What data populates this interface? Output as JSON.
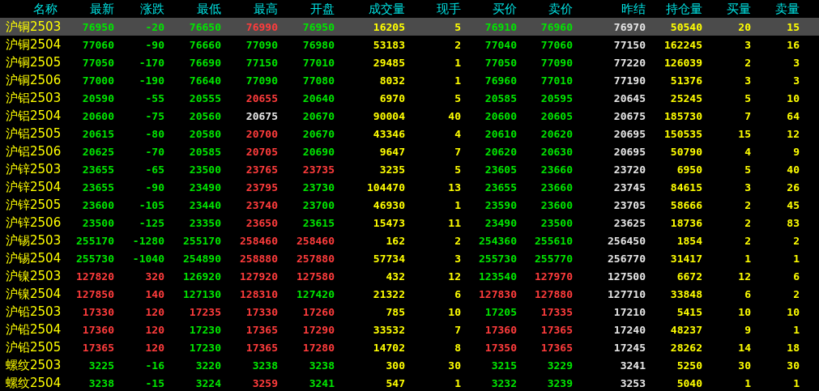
{
  "columns": [
    {
      "label": "名称"
    },
    {
      "label": "最新"
    },
    {
      "label": "涨跌"
    },
    {
      "label": "最低"
    },
    {
      "label": "最高"
    },
    {
      "label": "开盘"
    },
    {
      "label": "成交量",
      "color": "#ffff00"
    },
    {
      "label": "现手",
      "color": "#ffff00"
    },
    {
      "label": "买价"
    },
    {
      "label": "卖价"
    },
    {
      "label": "昨结",
      "color": "#e6e6e6"
    },
    {
      "label": "持仓量",
      "color": "#ffff00"
    },
    {
      "label": "买量",
      "color": "#ffff00"
    },
    {
      "label": "卖量",
      "color": "#ffff00"
    }
  ],
  "rows": [
    {
      "name": "沪铜2503",
      "selected": true,
      "cells": [
        {
          "text": "76950",
          "color": "#00e600"
        },
        {
          "text": "-20",
          "color": "#00e600"
        },
        {
          "text": "76650",
          "color": "#00e600"
        },
        {
          "text": "76990",
          "color": "#ff3c3c"
        },
        {
          "text": "76950",
          "color": "#00e600"
        },
        "16205",
        "5",
        {
          "text": "76910",
          "color": "#00e600"
        },
        {
          "text": "76960",
          "color": "#00e600"
        },
        "76970",
        "50540",
        "20",
        "15"
      ]
    },
    {
      "name": "沪铜2504",
      "selected": false,
      "cells": [
        {
          "text": "77060",
          "color": "#00e600"
        },
        {
          "text": "-90",
          "color": "#00e600"
        },
        {
          "text": "76660",
          "color": "#00e600"
        },
        {
          "text": "77090",
          "color": "#00e600"
        },
        {
          "text": "76980",
          "color": "#00e600"
        },
        "53183",
        "2",
        {
          "text": "77040",
          "color": "#00e600"
        },
        {
          "text": "77060",
          "color": "#00e600"
        },
        "77150",
        "162245",
        "3",
        "16"
      ]
    },
    {
      "name": "沪铜2505",
      "selected": false,
      "cells": [
        {
          "text": "77050",
          "color": "#00e600"
        },
        {
          "text": "-170",
          "color": "#00e600"
        },
        {
          "text": "76690",
          "color": "#00e600"
        },
        {
          "text": "77150",
          "color": "#00e600"
        },
        {
          "text": "77010",
          "color": "#00e600"
        },
        "29485",
        "1",
        {
          "text": "77050",
          "color": "#00e600"
        },
        {
          "text": "77090",
          "color": "#00e600"
        },
        "77220",
        "126039",
        "2",
        "3"
      ]
    },
    {
      "name": "沪铜2506",
      "selected": false,
      "cells": [
        {
          "text": "77000",
          "color": "#00e600"
        },
        {
          "text": "-190",
          "color": "#00e600"
        },
        {
          "text": "76640",
          "color": "#00e600"
        },
        {
          "text": "77090",
          "color": "#00e600"
        },
        {
          "text": "77080",
          "color": "#00e600"
        },
        "8032",
        "1",
        {
          "text": "76960",
          "color": "#00e600"
        },
        {
          "text": "77010",
          "color": "#00e600"
        },
        "77190",
        "51376",
        "3",
        "3"
      ]
    },
    {
      "name": "沪铝2503",
      "selected": false,
      "cells": [
        {
          "text": "20590",
          "color": "#00e600"
        },
        {
          "text": "-55",
          "color": "#00e600"
        },
        {
          "text": "20555",
          "color": "#00e600"
        },
        {
          "text": "20655",
          "color": "#ff3c3c"
        },
        {
          "text": "20640",
          "color": "#00e600"
        },
        "6970",
        "5",
        {
          "text": "20585",
          "color": "#00e600"
        },
        {
          "text": "20595",
          "color": "#00e600"
        },
        "20645",
        "25245",
        "5",
        "10"
      ]
    },
    {
      "name": "沪铝2504",
      "selected": false,
      "cells": [
        {
          "text": "20600",
          "color": "#00e600"
        },
        {
          "text": "-75",
          "color": "#00e600"
        },
        {
          "text": "20560",
          "color": "#00e600"
        },
        {
          "text": "20675",
          "color": "#e6e6e6"
        },
        {
          "text": "20670",
          "color": "#00e600"
        },
        "90004",
        "40",
        {
          "text": "20600",
          "color": "#00e600"
        },
        {
          "text": "20605",
          "color": "#00e600"
        },
        "20675",
        "185730",
        "7",
        "64"
      ]
    },
    {
      "name": "沪铝2505",
      "selected": false,
      "cells": [
        {
          "text": "20615",
          "color": "#00e600"
        },
        {
          "text": "-80",
          "color": "#00e600"
        },
        {
          "text": "20580",
          "color": "#00e600"
        },
        {
          "text": "20700",
          "color": "#ff3c3c"
        },
        {
          "text": "20670",
          "color": "#00e600"
        },
        "43346",
        "4",
        {
          "text": "20610",
          "color": "#00e600"
        },
        {
          "text": "20620",
          "color": "#00e600"
        },
        "20695",
        "150535",
        "15",
        "12"
      ]
    },
    {
      "name": "沪铝2506",
      "selected": false,
      "cells": [
        {
          "text": "20625",
          "color": "#00e600"
        },
        {
          "text": "-70",
          "color": "#00e600"
        },
        {
          "text": "20585",
          "color": "#00e600"
        },
        {
          "text": "20705",
          "color": "#ff3c3c"
        },
        {
          "text": "20690",
          "color": "#00e600"
        },
        "9647",
        "7",
        {
          "text": "20620",
          "color": "#00e600"
        },
        {
          "text": "20630",
          "color": "#00e600"
        },
        "20695",
        "50790",
        "4",
        "9"
      ]
    },
    {
      "name": "沪锌2503",
      "selected": false,
      "cells": [
        {
          "text": "23655",
          "color": "#00e600"
        },
        {
          "text": "-65",
          "color": "#00e600"
        },
        {
          "text": "23500",
          "color": "#00e600"
        },
        {
          "text": "23765",
          "color": "#ff3c3c"
        },
        {
          "text": "23735",
          "color": "#ff3c3c"
        },
        "3235",
        "5",
        {
          "text": "23605",
          "color": "#00e600"
        },
        {
          "text": "23660",
          "color": "#00e600"
        },
        "23720",
        "6950",
        "5",
        "40"
      ]
    },
    {
      "name": "沪锌2504",
      "selected": false,
      "cells": [
        {
          "text": "23655",
          "color": "#00e600"
        },
        {
          "text": "-90",
          "color": "#00e600"
        },
        {
          "text": "23490",
          "color": "#00e600"
        },
        {
          "text": "23795",
          "color": "#ff3c3c"
        },
        {
          "text": "23730",
          "color": "#00e600"
        },
        "104470",
        "13",
        {
          "text": "23655",
          "color": "#00e600"
        },
        {
          "text": "23660",
          "color": "#00e600"
        },
        "23745",
        "84615",
        "3",
        "26"
      ]
    },
    {
      "name": "沪锌2505",
      "selected": false,
      "cells": [
        {
          "text": "23600",
          "color": "#00e600"
        },
        {
          "text": "-105",
          "color": "#00e600"
        },
        {
          "text": "23440",
          "color": "#00e600"
        },
        {
          "text": "23740",
          "color": "#ff3c3c"
        },
        {
          "text": "23700",
          "color": "#00e600"
        },
        "46930",
        "1",
        {
          "text": "23590",
          "color": "#00e600"
        },
        {
          "text": "23600",
          "color": "#00e600"
        },
        "23705",
        "58666",
        "2",
        "45"
      ]
    },
    {
      "name": "沪锌2506",
      "selected": false,
      "cells": [
        {
          "text": "23500",
          "color": "#00e600"
        },
        {
          "text": "-125",
          "color": "#00e600"
        },
        {
          "text": "23350",
          "color": "#00e600"
        },
        {
          "text": "23650",
          "color": "#ff3c3c"
        },
        {
          "text": "23615",
          "color": "#00e600"
        },
        "15473",
        "11",
        {
          "text": "23490",
          "color": "#00e600"
        },
        {
          "text": "23500",
          "color": "#00e600"
        },
        "23625",
        "18736",
        "2",
        "83"
      ]
    },
    {
      "name": "沪锡2503",
      "selected": false,
      "cells": [
        {
          "text": "255170",
          "color": "#00e600"
        },
        {
          "text": "-1280",
          "color": "#00e600"
        },
        {
          "text": "255170",
          "color": "#00e600"
        },
        {
          "text": "258460",
          "color": "#ff3c3c"
        },
        {
          "text": "258460",
          "color": "#ff3c3c"
        },
        "162",
        "2",
        {
          "text": "254360",
          "color": "#00e600"
        },
        {
          "text": "255610",
          "color": "#00e600"
        },
        "256450",
        "1854",
        "2",
        "2"
      ]
    },
    {
      "name": "沪锡2504",
      "selected": false,
      "cells": [
        {
          "text": "255730",
          "color": "#00e600"
        },
        {
          "text": "-1040",
          "color": "#00e600"
        },
        {
          "text": "254890",
          "color": "#00e600"
        },
        {
          "text": "258880",
          "color": "#ff3c3c"
        },
        {
          "text": "257880",
          "color": "#ff3c3c"
        },
        "57734",
        "3",
        {
          "text": "255730",
          "color": "#00e600"
        },
        {
          "text": "255770",
          "color": "#00e600"
        },
        "256770",
        "31417",
        "1",
        "1"
      ]
    },
    {
      "name": "沪镍2503",
      "selected": false,
      "cells": [
        {
          "text": "127820",
          "color": "#ff3c3c"
        },
        {
          "text": "320",
          "color": "#ff3c3c"
        },
        {
          "text": "126920",
          "color": "#00e600"
        },
        {
          "text": "127920",
          "color": "#ff3c3c"
        },
        {
          "text": "127580",
          "color": "#ff3c3c"
        },
        "432",
        "12",
        {
          "text": "123540",
          "color": "#00e600"
        },
        {
          "text": "127970",
          "color": "#ff3c3c"
        },
        "127500",
        "6672",
        "12",
        "6"
      ]
    },
    {
      "name": "沪镍2504",
      "selected": false,
      "cells": [
        {
          "text": "127850",
          "color": "#ff3c3c"
        },
        {
          "text": "140",
          "color": "#ff3c3c"
        },
        {
          "text": "127130",
          "color": "#00e600"
        },
        {
          "text": "128310",
          "color": "#ff3c3c"
        },
        {
          "text": "127420",
          "color": "#00e600"
        },
        "21322",
        "6",
        {
          "text": "127830",
          "color": "#ff3c3c"
        },
        {
          "text": "127880",
          "color": "#ff3c3c"
        },
        "127710",
        "33848",
        "6",
        "2"
      ]
    },
    {
      "name": "沪铅2503",
      "selected": false,
      "cells": [
        {
          "text": "17330",
          "color": "#ff3c3c"
        },
        {
          "text": "120",
          "color": "#ff3c3c"
        },
        {
          "text": "17235",
          "color": "#ff3c3c"
        },
        {
          "text": "17330",
          "color": "#ff3c3c"
        },
        {
          "text": "17260",
          "color": "#ff3c3c"
        },
        "785",
        "10",
        {
          "text": "17205",
          "color": "#00e600"
        },
        {
          "text": "17335",
          "color": "#ff3c3c"
        },
        "17210",
        "5415",
        "10",
        "10"
      ]
    },
    {
      "name": "沪铅2504",
      "selected": false,
      "cells": [
        {
          "text": "17360",
          "color": "#ff3c3c"
        },
        {
          "text": "120",
          "color": "#ff3c3c"
        },
        {
          "text": "17230",
          "color": "#00e600"
        },
        {
          "text": "17365",
          "color": "#ff3c3c"
        },
        {
          "text": "17290",
          "color": "#ff3c3c"
        },
        "33532",
        "7",
        {
          "text": "17360",
          "color": "#ff3c3c"
        },
        {
          "text": "17365",
          "color": "#ff3c3c"
        },
        "17240",
        "48237",
        "9",
        "1"
      ]
    },
    {
      "name": "沪铅2505",
      "selected": false,
      "cells": [
        {
          "text": "17365",
          "color": "#ff3c3c"
        },
        {
          "text": "120",
          "color": "#ff3c3c"
        },
        {
          "text": "17230",
          "color": "#00e600"
        },
        {
          "text": "17365",
          "color": "#ff3c3c"
        },
        {
          "text": "17280",
          "color": "#ff3c3c"
        },
        "14702",
        "8",
        {
          "text": "17350",
          "color": "#ff3c3c"
        },
        {
          "text": "17365",
          "color": "#ff3c3c"
        },
        "17245",
        "28262",
        "14",
        "18"
      ]
    },
    {
      "name": "螺纹2503",
      "selected": false,
      "cells": [
        {
          "text": "3225",
          "color": "#00e600"
        },
        {
          "text": "-16",
          "color": "#00e600"
        },
        {
          "text": "3220",
          "color": "#00e600"
        },
        {
          "text": "3238",
          "color": "#00e600"
        },
        {
          "text": "3238",
          "color": "#00e600"
        },
        "300",
        "30",
        {
          "text": "3215",
          "color": "#00e600"
        },
        {
          "text": "3229",
          "color": "#00e600"
        },
        "3241",
        "5250",
        "30",
        "30"
      ]
    },
    {
      "name": "螺纹2504",
      "selected": false,
      "cells": [
        {
          "text": "3238",
          "color": "#00e600"
        },
        {
          "text": "-15",
          "color": "#00e600"
        },
        {
          "text": "3224",
          "color": "#00e600"
        },
        {
          "text": "3259",
          "color": "#ff3c3c"
        },
        {
          "text": "3241",
          "color": "#00e600"
        },
        "547",
        "1",
        {
          "text": "3232",
          "color": "#00e600"
        },
        {
          "text": "3239",
          "color": "#00e600"
        },
        "3253",
        "5040",
        "1",
        "1"
      ]
    }
  ]
}
